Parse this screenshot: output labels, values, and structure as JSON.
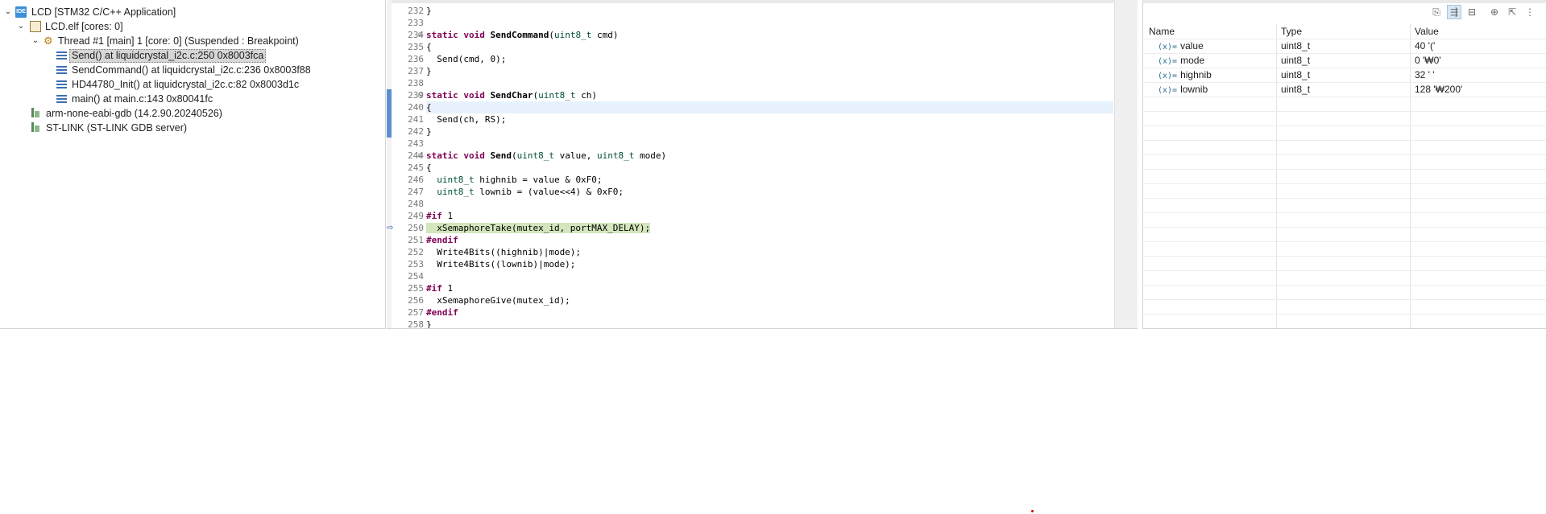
{
  "debug_tree": {
    "launch": "LCD [STM32 C/C++ Application]",
    "elf": "LCD.elf [cores: 0]",
    "thread": "Thread #1 [main] 1 [core: 0] (Suspended : Breakpoint)",
    "frames": [
      "Send() at liquidcrystal_i2c.c:250 0x8003fca",
      "SendCommand() at liquidcrystal_i2c.c:236 0x8003f88",
      "HD44780_Init() at liquidcrystal_i2c.c:82 0x8003d1c",
      "main() at main.c:143 0x80041fc"
    ],
    "gdb": "arm-none-eabi-gdb (14.2.90.20240526)",
    "server": "ST-LINK (ST-LINK GDB server)",
    "icons": {
      "launch": "IDE",
      "thread": "⚙"
    }
  },
  "editor": {
    "lines": [
      {
        "n": "232",
        "t": "}"
      },
      {
        "n": "233",
        "t": ""
      },
      {
        "n": "234",
        "t": "static void SendCommand(uint8_t cmd)"
      },
      {
        "n": "235",
        "t": "{"
      },
      {
        "n": "236",
        "t": "  Send(cmd, 0);"
      },
      {
        "n": "237",
        "t": "}"
      },
      {
        "n": "238",
        "t": ""
      },
      {
        "n": "239",
        "t": "static void SendChar(uint8_t ch)"
      },
      {
        "n": "240",
        "t": "{"
      },
      {
        "n": "241",
        "t": "  Send(ch, RS);"
      },
      {
        "n": "242",
        "t": "}"
      },
      {
        "n": "243",
        "t": ""
      },
      {
        "n": "244",
        "t": "static void Send(uint8_t value, uint8_t mode)"
      },
      {
        "n": "245",
        "t": "{"
      },
      {
        "n": "246",
        "t": "  uint8_t highnib = value & 0xF0;"
      },
      {
        "n": "247",
        "t": "  uint8_t lownib = (value<<4) & 0xF0;"
      },
      {
        "n": "248",
        "t": ""
      },
      {
        "n": "249",
        "t": "#if 1"
      },
      {
        "n": "250",
        "t": "  xSemaphoreTake(mutex_id, portMAX_DELAY);"
      },
      {
        "n": "251",
        "t": "#endif"
      },
      {
        "n": "252",
        "t": "  Write4Bits((highnib)|mode);"
      },
      {
        "n": "253",
        "t": "  Write4Bits((lownib)|mode);"
      },
      {
        "n": "254",
        "t": ""
      },
      {
        "n": "255",
        "t": "#if 1"
      },
      {
        "n": "256",
        "t": "  xSemaphoreGive(mutex_id);"
      },
      {
        "n": "257",
        "t": "#endif"
      },
      {
        "n": "258",
        "t": "}"
      }
    ]
  },
  "variables": {
    "headers": {
      "name": "Name",
      "type": "Type",
      "value": "Value"
    },
    "var_icon": "(x)=",
    "rows": [
      {
        "name": "value",
        "type": "uint8_t",
        "value": "40 '('"
      },
      {
        "name": "mode",
        "type": "uint8_t",
        "value": "0 '₩0'"
      },
      {
        "name": "highnib",
        "type": "uint8_t",
        "value": "32 ' '"
      },
      {
        "name": "lownib",
        "type": "uint8_t",
        "value": "128 '₩200'"
      }
    ]
  }
}
